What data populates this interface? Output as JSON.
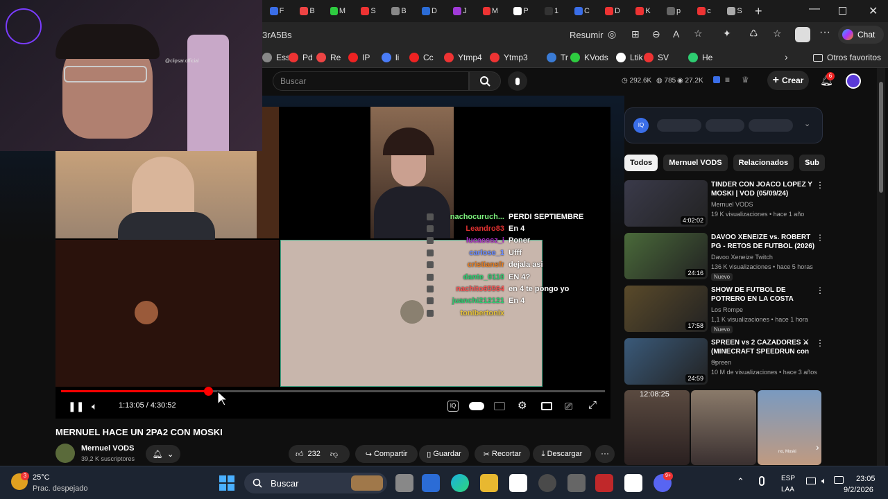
{
  "browser": {
    "tab_letters": [
      "F",
      "B",
      "M",
      "S",
      "B",
      "D",
      "J",
      "M",
      "P",
      "1",
      "C",
      "D",
      "K",
      "p",
      "c",
      "S"
    ],
    "address_text": "3rA5Bs",
    "resume_label": "Resumir",
    "chat_label": "Chat",
    "bookmarks": [
      {
        "label": "Ess",
        "color": "#888"
      },
      {
        "label": "Pd",
        "color": "#e33"
      },
      {
        "label": "Re",
        "color": "#e44"
      },
      {
        "label": "IP",
        "color": "#e22"
      },
      {
        "label": "li",
        "color": "#4a7cf7"
      },
      {
        "label": "Cc",
        "color": "#e22"
      },
      {
        "label": "Ytmp4",
        "color": "#e33"
      },
      {
        "label": "Ytmp3",
        "color": "#e33"
      },
      {
        "label": "Tr",
        "color": "#3a7bd5"
      },
      {
        "label": "KVods",
        "color": "#2ecc40"
      },
      {
        "label": "Ltik",
        "color": "#fff"
      },
      {
        "label": "SV",
        "color": "#e33"
      },
      {
        "label": "He",
        "color": "#2ecc71"
      }
    ],
    "other_favorites": "Otros favoritos"
  },
  "youtube": {
    "search_placeholder": "Buscar",
    "stats": {
      "views": "292.6K",
      "likes": "785",
      "eye": "27.2K"
    },
    "create_label": "Crear",
    "notif_count": "6",
    "filter_chips": [
      "Todos",
      "Mernuel VODS",
      "Relacionados",
      "Sub"
    ],
    "video": {
      "time": "1:13:05 / 4:30:52",
      "progress_fraction": 0.27,
      "title": "MERNUEL HACE UN 2PA2 CON MOSKI",
      "channel": "Mernuel VODS",
      "subscribers": "39,2 K suscriptores",
      "likes": "232",
      "share": "Compartir",
      "save": "Guardar",
      "clip": "Recortar",
      "download": "Descargar"
    },
    "overlay": {
      "streamer_tag": "@clipsar.official"
    },
    "chat": [
      {
        "user": "nachocuruch...",
        "msg": "PERDI SEPTIEMBRE",
        "color": "#7cf07c"
      },
      {
        "user": "Leandro83",
        "msg": "En 4",
        "color": "#e03030"
      },
      {
        "user": "lucasssz_i",
        "msg": "Poner",
        "color": "#b030d0"
      },
      {
        "user": "carlose_1",
        "msg": "Ufff",
        "color": "#6b8cff"
      },
      {
        "user": "cristiansfr",
        "msg": "dejala asi",
        "color": "#e67e22"
      },
      {
        "user": "dante_0110",
        "msg": "EN 4?",
        "color": "#2ecc71"
      },
      {
        "user": "nachito65564",
        "msg": "en 4 te pongo yo",
        "color": "#ff5555"
      },
      {
        "user": "juanchi212121",
        "msg": "En 4",
        "color": "#2ecc71"
      },
      {
        "user": "tonibertonix",
        "msg": "",
        "color": "#e6c23a"
      }
    ],
    "recommendations": [
      {
        "title": "TINDER CON JOACO LOPEZ Y MOSKI | VOD (05/09/24)",
        "channel": "Mernuel VODS",
        "meta": "19 K visualizaciones • hace 1 año",
        "duration": "4:02:02",
        "badge": "",
        "thumb": "#3a3a4a"
      },
      {
        "title": "DAVOO XENEIZE vs. ROBERT PG - RETOS DE FUTBOL (2026)",
        "channel": "Davoo Xeneize Twitch",
        "meta": "136 K visualizaciones • hace 5 horas",
        "duration": "24:16",
        "badge": "Nuevo",
        "thumb": "#4a6a3a"
      },
      {
        "title": "SHOW DE FUTBOL DE POTRERO EN LA COSTA",
        "channel": "Los Rompe",
        "meta": "1,1 K visualizaciones • hace 1 hora",
        "duration": "17:58",
        "badge": "Nuevo",
        "thumb": "#5a4a2a"
      },
      {
        "title": "SPREEN vs 2 CAZADORES ⚔ (MINECRAFT SPEEDRUN con ...",
        "channel": "Spreen",
        "meta": "10 M de visualizaciones • hace 3 años",
        "duration": "24:59",
        "badge": "",
        "thumb": "#3a5a7a"
      }
    ],
    "shorts_time": "12:08:25",
    "short_overlay_text": "no, Moski"
  },
  "taskbar": {
    "temp": "25°C",
    "weather": "Prac. despejado",
    "search_label": "Buscar",
    "lang": "ESP",
    "lang2": "LAA",
    "time": "23:05",
    "date": "9/2/2026",
    "weather_badge": "3",
    "discord_badge": "9+"
  }
}
